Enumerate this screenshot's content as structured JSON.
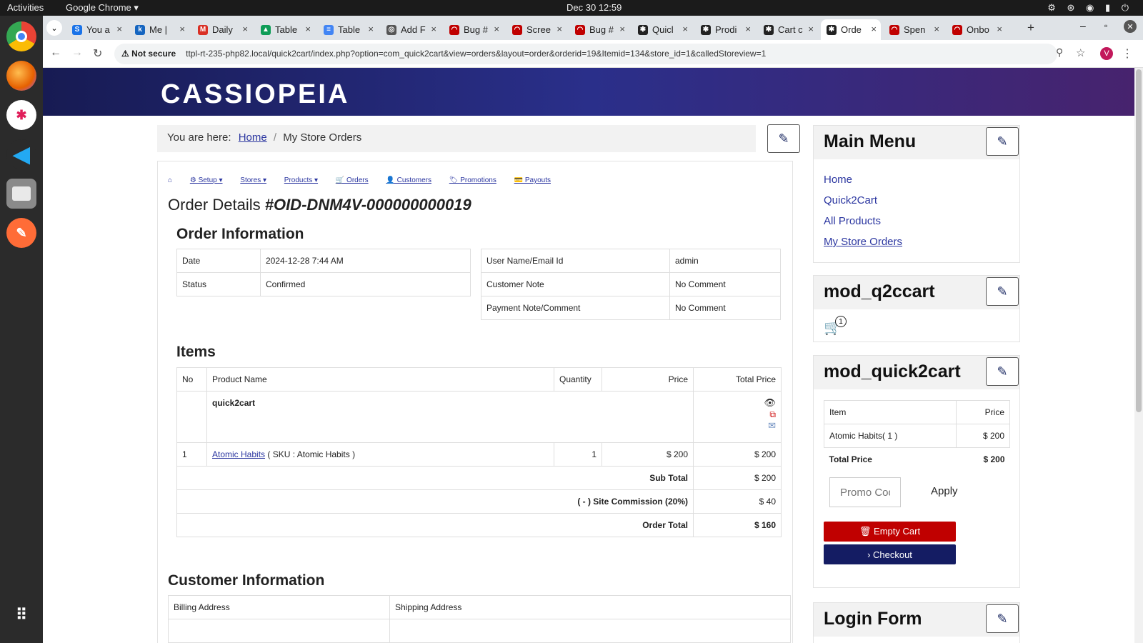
{
  "os": {
    "activities": "Activities",
    "app": "Google Chrome ▾",
    "clock": "Dec 30  12:59",
    "tray": "⚙ ⊛ ◉ ▮ ⏻"
  },
  "browser": {
    "tabs": [
      {
        "label": "You a",
        "color": "#1a73e8",
        "icon": "S"
      },
      {
        "label": "Me |",
        "color": "#1565c0",
        "icon": "k"
      },
      {
        "label": "Daily",
        "color": "#d93025",
        "icon": "M"
      },
      {
        "label": "Table",
        "color": "#0f9d58",
        "icon": "▲"
      },
      {
        "label": "Table",
        "color": "#4285f4",
        "icon": "≡"
      },
      {
        "label": "Add F",
        "color": "#555555",
        "icon": "◎"
      },
      {
        "label": "Bug #",
        "color": "#c00000",
        "icon": "◠"
      },
      {
        "label": "Scree",
        "color": "#c00000",
        "icon": "◠"
      },
      {
        "label": "Bug #",
        "color": "#c00000",
        "icon": "◠"
      },
      {
        "label": "Quicl",
        "color": "#222222",
        "icon": "✱"
      },
      {
        "label": "Prodi",
        "color": "#222222",
        "icon": "✱"
      },
      {
        "label": "Cart c",
        "color": "#222222",
        "icon": "✱"
      },
      {
        "label": "Orde",
        "color": "#222222",
        "icon": "✱"
      },
      {
        "label": "Spen",
        "color": "#c00000",
        "icon": "◠"
      },
      {
        "label": "Onbo",
        "color": "#c00000",
        "icon": "◠"
      }
    ],
    "new_tab": "+",
    "not_secure": "⚠ Not secure",
    "url": "ttpl-rt-235-php82.local/quick2cart/index.php?option=com_quick2cart&view=orders&layout=order&orderid=19&Itemid=134&store_id=1&calledStoreview=1",
    "profile": "V"
  },
  "site": {
    "brand": "CASSIOPEIA",
    "breadcrumb": {
      "prefix": "You are here:",
      "home": "Home",
      "sep": "/",
      "current": "My Store Orders"
    },
    "toolbar": {
      "home": "⌂",
      "setup": "⚙ Setup ▾",
      "stores": "Stores ▾",
      "products": "Products ▾",
      "orders": "🛒 Orders",
      "customers": "👤 Customers",
      "promotions": "🏷 Promotions",
      "payouts": "💳 Payouts"
    },
    "title_prefix": "Order Details ",
    "order_id": "#OID-DNM4V-000000000019",
    "order_info": {
      "heading": "Order Information",
      "date_label": "Date",
      "date": "2024-12-28 7:44 AM",
      "status_label": "Status",
      "status": "Confirmed",
      "user_label": "User Name/Email Id",
      "user": "admin",
      "cnote_label": "Customer Note",
      "cnote": "No Comment",
      "pnote_label": "Payment Note/Comment",
      "pnote": "No Comment"
    },
    "items": {
      "heading": "Items",
      "cols": [
        "No",
        "Product Name",
        "Quantity",
        "Price",
        "Total Price"
      ],
      "store": "quick2cart",
      "row": {
        "no": "1",
        "name": "Atomic Habits",
        "sku": " ( SKU : Atomic Habits )",
        "qty": "1",
        "price": "$ 200",
        "total": "$ 200"
      },
      "subtotal_label": "Sub Total",
      "subtotal": "$ 200",
      "commission_label": "( - ) Site Commission (20%)",
      "commission": "$ 40",
      "order_total_label": "Order Total",
      "order_total": "$ 160"
    },
    "customer": {
      "heading": "Customer Information",
      "billing": "Billing Address",
      "shipping": "Shipping Address"
    }
  },
  "sidebar": {
    "main_menu": {
      "title": "Main Menu",
      "items": [
        "Home",
        "Quick2Cart",
        "All Products",
        "My Store Orders"
      ]
    },
    "q2ccart": {
      "title": "mod_q2ccart",
      "count": "1"
    },
    "quick2cart": {
      "title": "mod_quick2cart",
      "col_item": "Item",
      "col_price": "Price",
      "item": "Atomic Habits( 1 )",
      "item_price": "$ 200",
      "total_label": "Total Price",
      "total": "$ 200",
      "promo_placeholder": "Promo Code",
      "apply": "Apply",
      "empty": "🗑 Empty Cart",
      "checkout": "› Checkout"
    },
    "login": {
      "title": "Login Form"
    }
  }
}
